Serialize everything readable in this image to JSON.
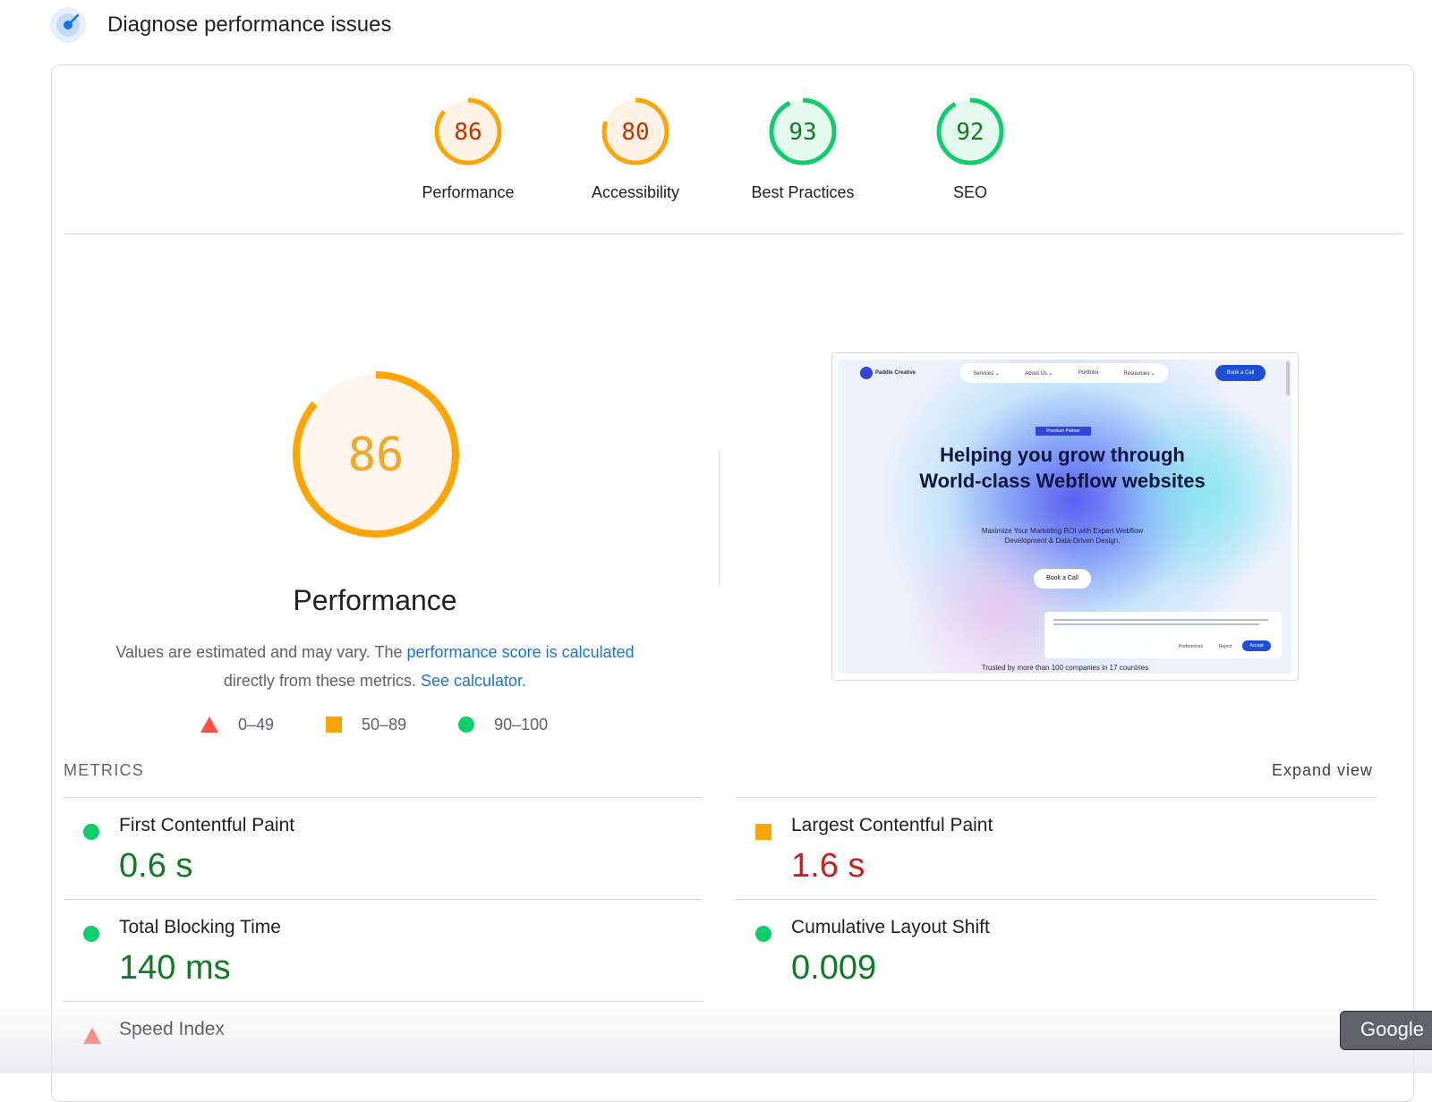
{
  "header": {
    "title": "Diagnose performance issues",
    "icon": "lighthouse-icon"
  },
  "categories": [
    {
      "score": "86",
      "label": "Performance",
      "level": "average"
    },
    {
      "score": "80",
      "label": "Accessibility",
      "level": "average"
    },
    {
      "score": "93",
      "label": "Best Practices",
      "level": "good"
    },
    {
      "score": "92",
      "label": "SEO",
      "level": "good"
    }
  ],
  "performance": {
    "score": "86",
    "title": "Performance",
    "desc_prefix": "Values are estimated and may vary. The ",
    "link_text": "performance score is calculated",
    "desc_middle": "directly from these metrics. ",
    "calculator_link": "See calculator."
  },
  "legend": [
    {
      "label": "0–49",
      "shape": "triangle",
      "color": "#ff4e42"
    },
    {
      "label": "50–89",
      "shape": "square",
      "color": "#ffa400"
    },
    {
      "label": "90–100",
      "shape": "circle",
      "color": "#0cce6b"
    }
  ],
  "screenshot": {
    "logo": "Paddle Creative",
    "nav": [
      "Services ⌄",
      "About Us ⌄",
      "Portfolio",
      "Resources ⌄"
    ],
    "book_button": "Book a Call",
    "badge": "Premium Partner",
    "headline": "Helping you grow through World-class Webflow websites",
    "subtext": "Maximize Your Marketing ROI with Expert Webflow Development & Data-Driven Design.",
    "cta": "Book a Call",
    "cookie_options": [
      "Preferences",
      "Reject",
      "Accept"
    ],
    "trust": "Trusted by more than 100 companies in 17 countries"
  },
  "metrics": {
    "header": "METRICS",
    "expand_label": "Expand view",
    "items": [
      {
        "name": "First Contentful Paint",
        "value": "0.6 s",
        "level": "good"
      },
      {
        "name": "Largest Contentful Paint",
        "value": "1.6 s",
        "level": "average"
      },
      {
        "name": "Total Blocking Time",
        "value": "140 ms",
        "level": "good"
      },
      {
        "name": "Cumulative Layout Shift",
        "value": "0.009",
        "level": "good"
      },
      {
        "name": "Speed Index",
        "value": "",
        "level": "poor"
      }
    ]
  },
  "tooltip": {
    "label": "Google"
  },
  "colors": {
    "good": "#0cce6b",
    "average": "#ffa400",
    "poor": "#ff4e42",
    "link": "#1a73e8"
  }
}
